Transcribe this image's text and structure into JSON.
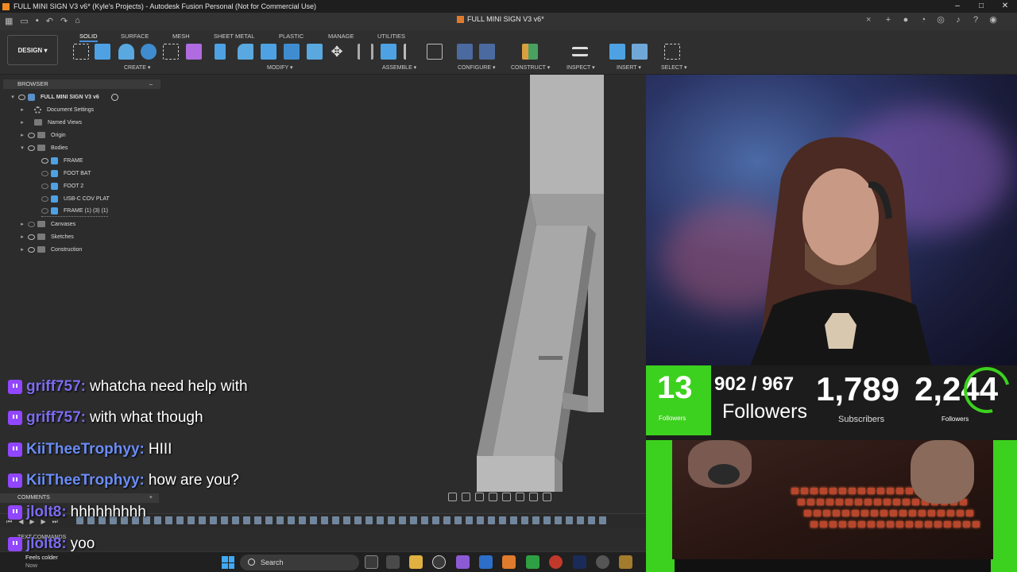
{
  "window": {
    "title": "FULL MINI SIGN V3 v6* (Kyle's Projects) - Autodesk Fusion Personal (Not for Commercial Use)",
    "controls": [
      "–",
      "□",
      "✕"
    ]
  },
  "doc_tab": {
    "label": "FULL MINI SIGN V3 v6*",
    "close": "×",
    "new": "+"
  },
  "workspace": {
    "label": "DESIGN",
    "chevron": "▾"
  },
  "ribbon_tabs": [
    "SOLID",
    "SURFACE",
    "MESH",
    "SHEET METAL",
    "PLASTIC",
    "MANAGE",
    "UTILITIES"
  ],
  "ribbon_groups": [
    "CREATE ▾",
    "MODIFY ▾",
    "ASSEMBLE ▾",
    "CONFIGURE ▾",
    "CONSTRUCT ▾",
    "INSPECT ▾",
    "INSERT ▾",
    "SELECT ▾"
  ],
  "browser": {
    "header": "BROWSER",
    "collapse": "–",
    "root": "FULL MINI SIGN V3 v6",
    "items": [
      {
        "label": "Document Settings",
        "type": "settings"
      },
      {
        "label": "Named Views",
        "type": "folder"
      },
      {
        "label": "Origin",
        "type": "folder"
      },
      {
        "label": "Bodies",
        "type": "folder"
      },
      {
        "label": "FRAME",
        "type": "body"
      },
      {
        "label": "FOOT BAT",
        "type": "body"
      },
      {
        "label": "FOOT 2",
        "type": "body"
      },
      {
        "label": "USB-C COV PLAT",
        "type": "body"
      },
      {
        "label": "FRAME (1) (3) (1)",
        "type": "body"
      },
      {
        "label": "Canvases",
        "type": "folder"
      },
      {
        "label": "Sketches",
        "type": "folder"
      },
      {
        "label": "Construction",
        "type": "folder"
      }
    ]
  },
  "comments": {
    "label": "COMMENTS",
    "add": "+"
  },
  "text_commands": {
    "label": "TEXT COMMANDS"
  },
  "chat": [
    {
      "user": "griff757:",
      "msg": "whatcha need help with",
      "color": "#7c6cf0"
    },
    {
      "user": "griff757:",
      "msg": "with what though",
      "color": "#7c6cf0"
    },
    {
      "user": "KiiTheeTrophyy:",
      "msg": "HIII",
      "color": "#6b8df7"
    },
    {
      "user": "KiiTheeTrophyy:",
      "msg": "how are you?",
      "color": "#6b8df7"
    },
    {
      "user": "jlolt8:",
      "msg": "hhhhhhhhh",
      "color": "#7c6cf0"
    },
    {
      "user": "jlolt8:",
      "msg": "yoo",
      "color": "#7c6cf0"
    }
  ],
  "taskbar": {
    "weather_title": "Feels colder",
    "weather_sub": "Now",
    "search_placeholder": "Search"
  },
  "stream_stats": {
    "session_followers": "13",
    "session_followers_label": "Followers",
    "goal_progress": "902 / 967",
    "goal_label": "Followers",
    "subscribers": "1,789",
    "subscribers_label": "Subscribers",
    "followers_total": "2,244",
    "followers_total_label": "Followers",
    "accent": "#3cd11e"
  },
  "colors": {
    "twitch": "#9146ff",
    "fusion_accent": "#f08a24"
  }
}
